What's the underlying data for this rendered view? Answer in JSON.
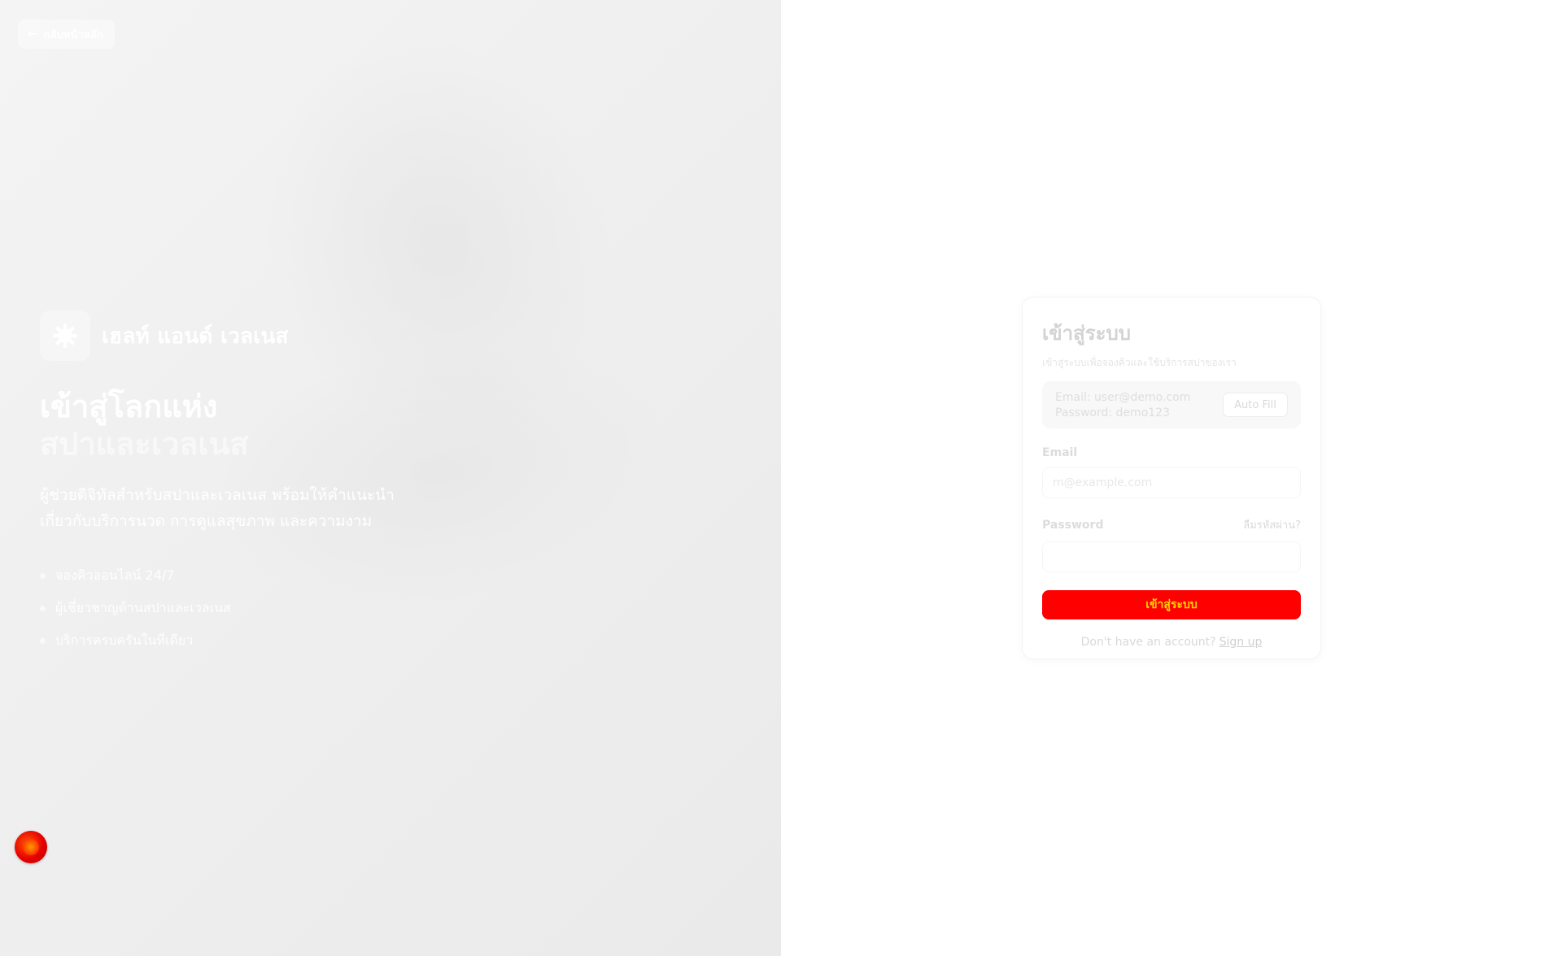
{
  "hero": {
    "back_label": "กลับหน้าหลัก",
    "back_icon": "arrow-left-icon",
    "brand_icon": "gear-icon",
    "brand_name": "เฮลท์ แอนด์ เวลเนส",
    "headline_line1": "เข้าสู่โลกแห่ง",
    "headline_line2": "สปาและเวลเนส",
    "description": "ผู้ช่วยดิจิทัลสำหรับสปาและเวลเนส พร้อมให้คำแนะนำเกี่ยวกับบริการนวด การดูแลสุขภาพ และความงาม",
    "features": [
      "จองคิวออนไลน์ 24/7",
      "ผู้เชี่ยวชาญด้านสปาและเวลเนส",
      "บริการครบครันในที่เดียว"
    ]
  },
  "login": {
    "title": "เข้าสู่ระบบ",
    "subtitle": "เข้าสู่ระบบเพื่อจองคิวและใช้บริการสปาของเรา",
    "demo_email": "Email: user@demo.com",
    "demo_password": "Password: demo123",
    "autofill_label": "Auto Fill",
    "email_label": "Email",
    "email_placeholder": "m@example.com",
    "password_label": "Password",
    "forgot_label": "ลืมรหัสผ่าน?",
    "submit_label": "เข้าสู่ระบบ",
    "no_account_text": "Don't have an account?",
    "signup_label": "Sign up"
  },
  "colors": {
    "accent": "#ff0000",
    "accent_text": "#ffd400",
    "hero_bg": "#efefef"
  }
}
